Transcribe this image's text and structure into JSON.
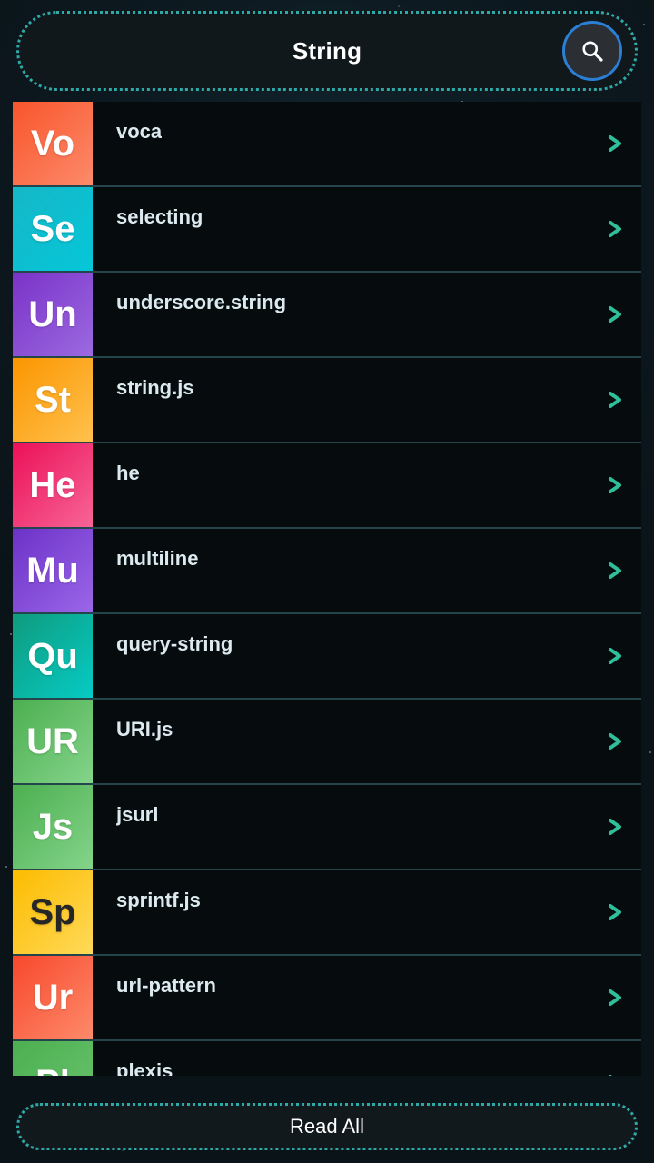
{
  "header": {
    "title": "String",
    "search_icon": "search-icon"
  },
  "list": {
    "items": [
      {
        "initials": "Vo",
        "label": "voca",
        "color_start": "#f8552c",
        "color_end": "#fd8a6a",
        "text_color": "#ffffff",
        "chevron": "chevron-right-icon"
      },
      {
        "initials": "Se",
        "label": "selecting",
        "color_start": "#16b7c6",
        "color_end": "#05c7d9",
        "text_color": "#ffffff",
        "chevron": "chevron-right-icon"
      },
      {
        "initials": "Un",
        "label": "underscore.string",
        "color_start": "#7a32c8",
        "color_end": "#9b6ae0",
        "text_color": "#ffffff",
        "chevron": "chevron-right-icon"
      },
      {
        "initials": "St",
        "label": "string.js",
        "color_start": "#fb9500",
        "color_end": "#ffc14d",
        "text_color": "#ffffff",
        "chevron": "chevron-right-icon"
      },
      {
        "initials": "He",
        "label": "he",
        "color_start": "#ec1059",
        "color_end": "#f76596",
        "text_color": "#ffffff",
        "chevron": "chevron-right-icon"
      },
      {
        "initials": "Mu",
        "label": "multiline",
        "color_start": "#6c32c8",
        "color_end": "#9b66e8",
        "text_color": "#ffffff",
        "chevron": "chevron-right-icon"
      },
      {
        "initials": "Qu",
        "label": "query-string",
        "color_start": "#0f9b7e",
        "color_end": "#06cbc4",
        "text_color": "#ffffff",
        "chevron": "chevron-right-icon"
      },
      {
        "initials": "UR",
        "label": "URI.js",
        "color_start": "#4caf50",
        "color_end": "#84d48a",
        "text_color": "#ffffff",
        "chevron": "chevron-right-icon"
      },
      {
        "initials": "Js",
        "label": "jsurl",
        "color_start": "#4caf50",
        "color_end": "#84d48a",
        "text_color": "#ffffff",
        "chevron": "chevron-right-icon"
      },
      {
        "initials": "Sp",
        "label": "sprintf.js",
        "color_start": "#fcbc00",
        "color_end": "#ffd958",
        "text_color": "#262626",
        "chevron": "chevron-right-icon"
      },
      {
        "initials": "Ur",
        "label": "url-pattern",
        "color_start": "#f8482c",
        "color_end": "#fd8a6a",
        "text_color": "#ffffff",
        "chevron": "chevron-right-icon"
      },
      {
        "initials": "Pl",
        "label": "plexis",
        "color_start": "#4caf50",
        "color_end": "#6bc46f",
        "text_color": "#ffffff",
        "chevron": "chevron-right-icon"
      }
    ]
  },
  "footer": {
    "read_all_label": "Read All"
  },
  "theme": {
    "accent_border": "#2fa8a8",
    "search_ring": "#2b7fd4",
    "chevron_color": "#2fbf9a",
    "row_background": "#060c0e",
    "row_divider": "#24454c",
    "label_color": "#dceaf0"
  }
}
